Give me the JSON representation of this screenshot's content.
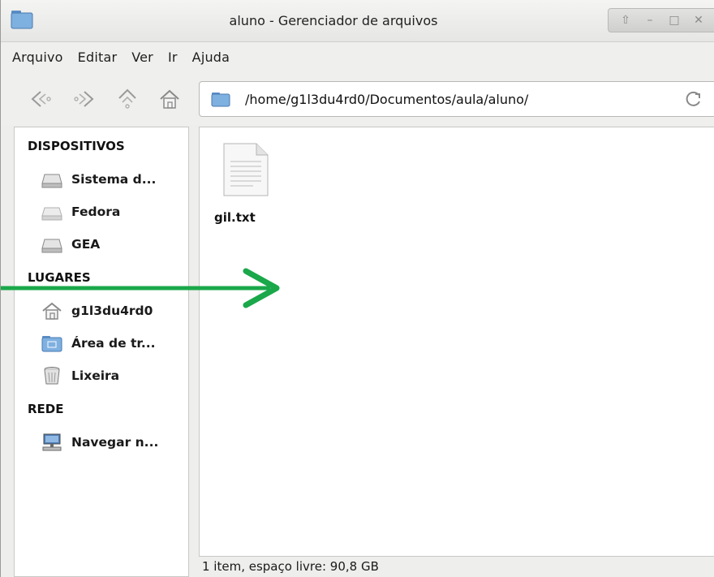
{
  "window": {
    "title": "aluno - Gerenciador de arquivos",
    "wm_buttons": [
      "⇧",
      "–",
      "□",
      "✕"
    ]
  },
  "menubar": {
    "items": [
      "Arquivo",
      "Editar",
      "Ver",
      "Ir",
      "Ajuda"
    ]
  },
  "toolbar": {
    "back_icon": "back-arrow-icon",
    "forward_icon": "forward-arrow-icon",
    "up_icon": "up-arrow-icon",
    "home_icon": "home-icon",
    "path": "/home/g1l3du4rd0/Documentos/aula/aluno/"
  },
  "sidebar": {
    "sections": [
      {
        "heading": "DISPOSITIVOS",
        "items": [
          {
            "label": "Sistema d...",
            "icon": "hard-drive-icon"
          },
          {
            "label": "Fedora",
            "icon": "drive-icon"
          },
          {
            "label": "GEA",
            "icon": "hard-drive-icon"
          }
        ]
      },
      {
        "heading": "LUGARES",
        "items": [
          {
            "label": "g1l3du4rd0",
            "icon": "home-icon"
          },
          {
            "label": "Área de tr...",
            "icon": "desktop-folder-icon"
          },
          {
            "label": "Lixeira",
            "icon": "trash-icon"
          }
        ]
      },
      {
        "heading": "REDE",
        "items": [
          {
            "label": "Navegar n...",
            "icon": "network-icon"
          }
        ]
      }
    ]
  },
  "main": {
    "files": [
      {
        "name": "gil.txt",
        "icon": "text-file-icon"
      }
    ]
  },
  "status": {
    "text": "1 item, espaço livre: 90,8 GB"
  },
  "colors": {
    "accent_green": "#1aa84a",
    "folder_blue": "#6fa8dc"
  }
}
